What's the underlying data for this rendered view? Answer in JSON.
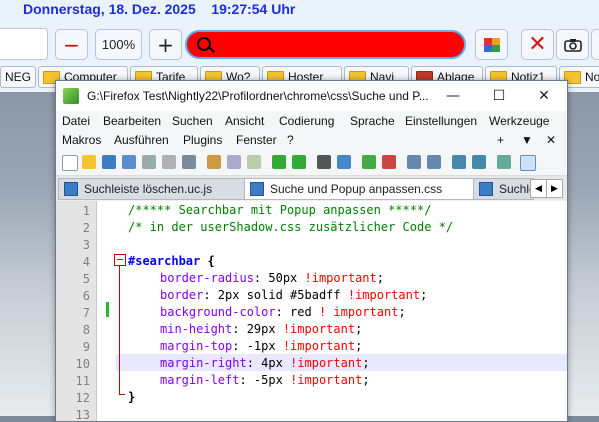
{
  "firefox": {
    "datetime": "Donnerstag, 18. Dez. 2025    19:27:54 Uhr",
    "zoom_label": "100%",
    "minus_label": "−",
    "plus_label": "+",
    "searchbar_color": "#ff0000",
    "searchbar_border": "#5badff",
    "bookmarks": [
      "NEG",
      "Computer",
      "Tarife",
      "Wo?",
      "Hoster",
      "Navi",
      "Ablage",
      "Notiz1",
      "Not"
    ]
  },
  "npp": {
    "title": "G:\\Firefox Test\\Nightly22\\Profilordner\\chrome\\css\\Suche und P...",
    "menu_row1": [
      "Datei",
      "Bearbeiten",
      "Suchen",
      "Ansicht",
      "Codierung",
      "Sprache",
      "Einstellungen",
      "Werkzeuge"
    ],
    "menu_row2": [
      "Makros",
      "Ausführen",
      "Plugins",
      "Fenster",
      "?"
    ],
    "menu_extra": [
      "+",
      "▼",
      "✕"
    ],
    "tabs": [
      "Suchleiste löschen.uc.js",
      "Suche und Popup anpassen.css",
      "Suchle"
    ],
    "line_numbers": [
      "1",
      "2",
      "3",
      "4",
      "5",
      "6",
      "7",
      "8",
      "9",
      "10",
      "11",
      "12",
      "13"
    ],
    "code": {
      "l1": "/***** Searchbar mit Popup anpassen *****/",
      "l2": "/* in der userShadow.css zusätzlicher Code */",
      "l4_sel": "#searchbar",
      "l4_brace": " {",
      "props": [
        {
          "p": "border-radius",
          "v": ": 50px ",
          "i": "!important",
          "e": ";"
        },
        {
          "p": "border",
          "v": ": 2px solid #5badff ",
          "i": "!important",
          "e": ";"
        },
        {
          "p": "background-color",
          "v": ": red ",
          "i": "! important",
          "e": ";"
        },
        {
          "p": "min-height",
          "v": ": 29px ",
          "i": "!important",
          "e": ";"
        },
        {
          "p": "margin-top",
          "v": ": -1px ",
          "i": "!important",
          "e": ";"
        },
        {
          "p": "margin-right",
          "v": ": 4px ",
          "i": "!important",
          "e": ";"
        },
        {
          "p": "margin-left",
          "v": ": -5px ",
          "i": "!important",
          "e": ";"
        }
      ],
      "l12": "}"
    }
  }
}
